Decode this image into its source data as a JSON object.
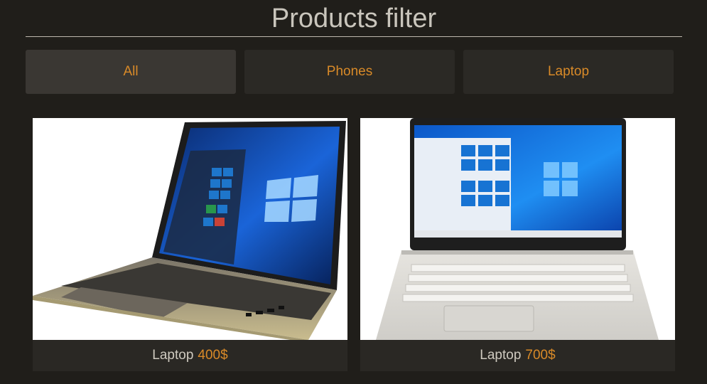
{
  "page": {
    "title": "Products filter"
  },
  "filters": [
    {
      "label": "All",
      "active": true
    },
    {
      "label": "Phones",
      "active": false
    },
    {
      "label": "Laptop",
      "active": false
    }
  ],
  "products": [
    {
      "name": "Laptop",
      "price": "400$",
      "image": "laptop-angled-windows-desktop"
    },
    {
      "name": "Laptop",
      "price": "700$",
      "image": "laptop-front-silver-windows-desktop"
    }
  ],
  "colors": {
    "background": "#201e1a",
    "accent": "#d98a28",
    "button": "#2b2925",
    "button_active": "#3a3733"
  }
}
